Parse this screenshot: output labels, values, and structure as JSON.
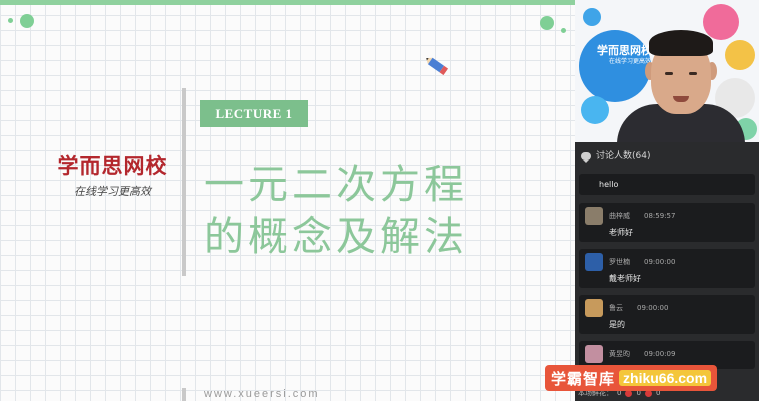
{
  "slide": {
    "brand_name": "学而思网校",
    "brand_slogan": "在线学习更高效",
    "lecture_label": "LECTURE 1",
    "title_line1": "一元二次方程",
    "title_line2": "的概念及解法",
    "footer_url": "www.xueersi.com"
  },
  "video": {
    "logo_text": "学而思网校",
    "logo_sub": "在线学习更高效"
  },
  "chat": {
    "header": "讨论人数(64)",
    "messages": [
      {
        "type": "plain",
        "text": "hello"
      },
      {
        "type": "user",
        "name": "曲梓威",
        "time": "08:59:57",
        "text": "老师好",
        "avatar_color": "#8a7d6a"
      },
      {
        "type": "user",
        "name": "罗世楠",
        "time": "09:00:00",
        "text": "戴老师好",
        "avatar_color": "#2d5fa8"
      },
      {
        "type": "user",
        "name": "鲁云",
        "time": "09:00:00",
        "text": "是的",
        "avatar_color": "#c79a5c"
      },
      {
        "type": "user",
        "name": "黄昱昀",
        "time": "09:00:09",
        "text": "",
        "avatar_color": "#c28fa0"
      }
    ]
  },
  "bottom_bar": {
    "label": "本场鲜花：",
    "count_a": "0",
    "count_b": "0",
    "count_c": "0"
  },
  "watermark": {
    "cn": "学霸智库",
    "en": "zhiku66.com"
  },
  "colors": {
    "slide_green": "#8cc79a",
    "badge_green": "#7cbf8c",
    "brand_red": "#b3272d",
    "panel_bg": "#2a2b2d",
    "watermark_orange": "#e8553a"
  }
}
